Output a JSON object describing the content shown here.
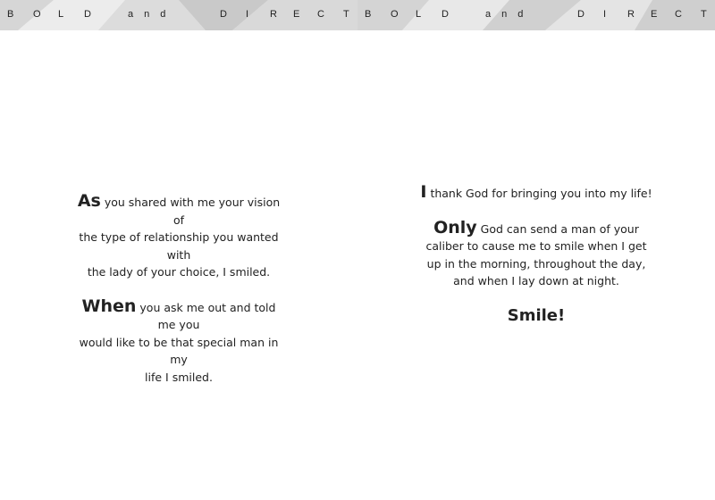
{
  "header": {
    "left_letters": [
      "B",
      "O",
      "L",
      "D",
      "and",
      "D",
      "I",
      "R",
      "E",
      "C",
      "T"
    ],
    "right_letters": [
      "B",
      "O",
      "L",
      "D",
      "and",
      "D",
      "I",
      "R",
      "E",
      "C",
      "T"
    ]
  },
  "left_page": {
    "p1_lead": "As",
    "p1_line1_rest": "you shared with me your vision of",
    "p1_line2": "the type of relationship you wanted with",
    "p1_line3": "the lady of your choice, I smiled.",
    "p2_lead": "When",
    "p2_line1_rest": "you ask me out and told me you",
    "p2_line2": "would like to be that special man in my",
    "p2_line3": "life I smiled."
  },
  "right_page": {
    "p1_lead": "I",
    "p1_rest": "thank God for bringing you into my life!",
    "p2_lead": "Only",
    "p2_line1_rest": "God can send a man of your",
    "p2_line2": "caliber to cause me to smile when I get",
    "p2_line3": "up in the morning, throughout the day,",
    "p2_line4": "and when I lay down at night.",
    "closing": "Smile!"
  }
}
